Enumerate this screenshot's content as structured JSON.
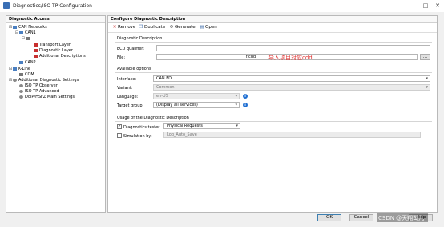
{
  "window": {
    "title": "Diagnostics/ISO TP Configuration",
    "minimize_glyph": "—",
    "maximize_glyph": "□",
    "close_glyph": "✕"
  },
  "left_panel": {
    "header": "Diagnostic Access",
    "tree": {
      "can_networks": "CAN Networks",
      "can1": "CAN1",
      "transport_layer": "Transport Layer",
      "diagnostic_layer": "Diagnostic Layer",
      "additional_descriptions": "Additional Descriptions",
      "can2": "CAN2",
      "k_line": "K-Line",
      "com": "COM",
      "additional_settings": "Additional Diagnostic Settings",
      "iso_tp_observer": "ISO TP Observer",
      "iso_tp_advanced": "ISO TP Advanced",
      "doip_settings": "DoIP/HSFZ Main Settings"
    }
  },
  "right_panel": {
    "header": "Configure Diagnostic Description",
    "toolbar": {
      "remove": "Remove",
      "duplicate": "Duplicate",
      "generate": "Generate",
      "open": "Open"
    },
    "diag_description": {
      "group": "Diagnostic Description",
      "ecu_qualifier_label": "ECU qualifier:",
      "ecu_qualifier_value": "",
      "file_label": "File:",
      "file_value": "f.cdd",
      "browse_label": "...",
      "annotation": "导入项目对应cdd"
    },
    "available_options": {
      "group": "Available options",
      "interface_label": "Interface:",
      "interface_value": "CAN FD",
      "variant_label": "Variant:",
      "variant_value": "Common",
      "language_label": "Language:",
      "language_value": "en-US",
      "target_group_label": "Target group:",
      "target_group_value": "(Display all services)"
    },
    "usage": {
      "group": "Usage of the Diagnostic Description",
      "diag_tester_label": "Diagnostics tester",
      "diag_tester_checked": true,
      "diag_tester_value": "Physical Requests",
      "simulation_label": "Simulation by:",
      "simulation_checked": false,
      "simulation_value": "Log_Auto_Save"
    }
  },
  "buttons": {
    "ok": "OK",
    "cancel": "Cancel",
    "help": "Help"
  },
  "watermark": "CSDN @天翔鹭儿",
  "glyphs": {
    "collapse": "⊟",
    "check": "✓",
    "combo": "▾",
    "info": "i",
    "remove": "✕",
    "duplicate": "❐",
    "generate": "⚙",
    "open": "▤"
  }
}
